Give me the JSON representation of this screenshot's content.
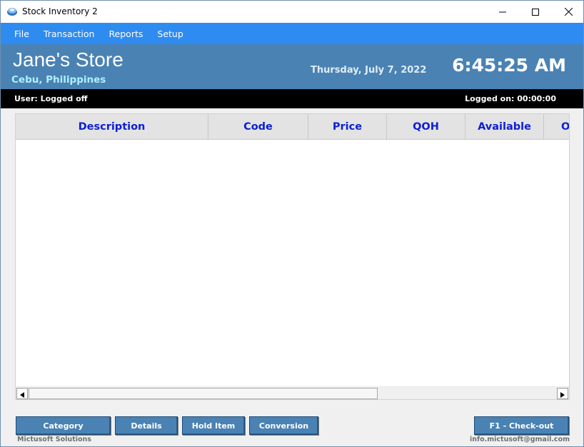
{
  "window": {
    "title": "Stock Inventory 2"
  },
  "menu": {
    "items": [
      "File",
      "Transaction",
      "Reports",
      "Setup"
    ]
  },
  "header": {
    "store_name": "Jane's Store",
    "location": "Cebu, Philippines",
    "date": "Thursday, July 7, 2022",
    "time": "6:45:25 AM"
  },
  "status": {
    "user": "User: Logged off",
    "logged_on": "Logged on:  00:00:00"
  },
  "grid": {
    "columns": [
      "Description",
      "Code",
      "Price",
      "QOH",
      "Available",
      "O"
    ]
  },
  "buttons": {
    "category": "Category",
    "details": "Details",
    "hold_item": "Hold Item",
    "conversion": "Conversion",
    "checkout": "F1 - Check-out"
  },
  "footer": {
    "company": "Mictusoft Solutions",
    "email": "info.mictusoft@gmail.com"
  },
  "colors": {
    "menu_bar": "#2e8bf0",
    "header": "#4a82b4",
    "column_header_text": "#0b1fd6"
  },
  "icons": {
    "app": "app-icon",
    "minimize": "minimize-icon",
    "maximize": "maximize-icon",
    "close": "close-icon",
    "scroll_left": "arrow-left-icon",
    "scroll_right": "arrow-right-icon"
  }
}
